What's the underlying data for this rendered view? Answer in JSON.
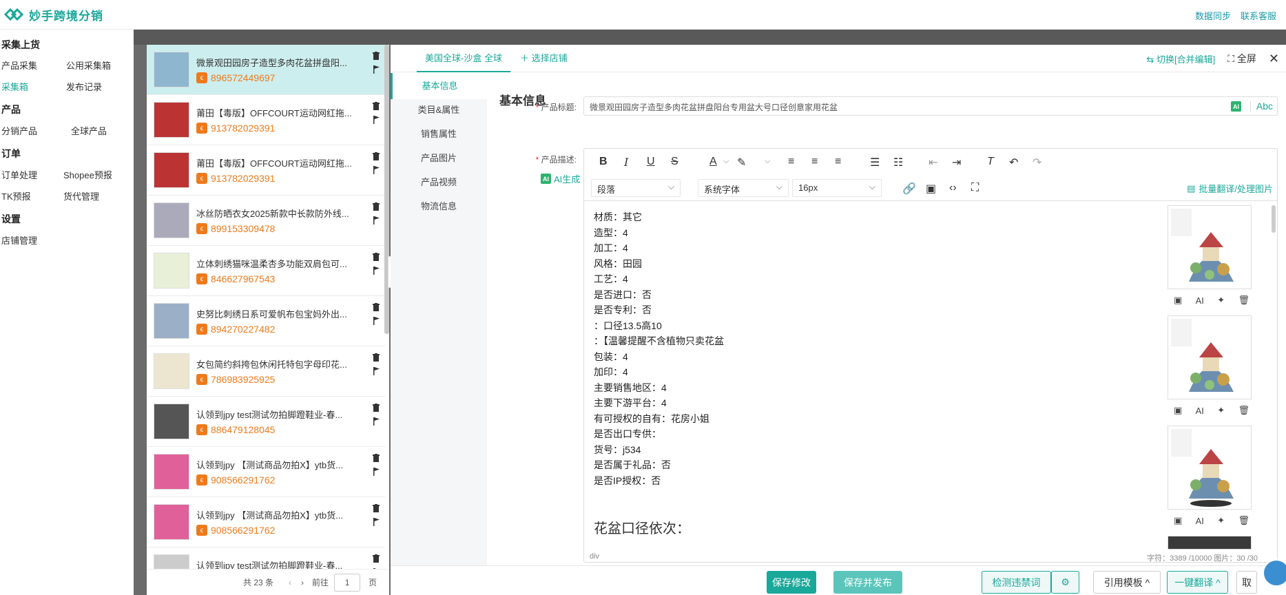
{
  "app": {
    "title": "妙手跨境分销"
  },
  "top_links": [
    "数据同步",
    "联系客服"
  ],
  "sidebar": {
    "groups": [
      {
        "label": "采集上货",
        "items": [
          "产品采集",
          "公用采集箱",
          "采集箱",
          "发布记录"
        ]
      },
      {
        "label": "产品",
        "items": [
          "分销产品",
          "全球产品"
        ]
      },
      {
        "label": "订单",
        "items": [
          "订单处理",
          "Shopee预报",
          "TK预报",
          "货代管理"
        ]
      },
      {
        "label": "设置",
        "items": [
          "店铺管理"
        ]
      }
    ],
    "active": "采集箱"
  },
  "products": [
    {
      "title": "微景观田园房子造型多肉花盆拼盘阳...",
      "id": "896572449697"
    },
    {
      "title": "莆田【毒版】OFFCOURT运动网红拖...",
      "id": "913782029391"
    },
    {
      "title": "莆田【毒版】OFFCOURT运动网红拖...",
      "id": "913782029391"
    },
    {
      "title": "冰丝防晒衣女2025新款中长款防外线...",
      "id": "899153309478"
    },
    {
      "title": "立体刺绣猫咪温柔杏多功能双肩包可...",
      "id": "846627967543"
    },
    {
      "title": "史努比刺绣日系可爱帆布包宝妈外出...",
      "id": "894270227482"
    },
    {
      "title": "女包简约斜挎包休闲托特包字母印花...",
      "id": "786983925925"
    },
    {
      "title": "认领到jpy test测试勿拍脚蹬鞋业-春...",
      "id": "886479128045"
    },
    {
      "title": "认领到jpy 【测试商品勿拍X】ytb货...",
      "id": "908566291762"
    },
    {
      "title": "认领到jpy 【测试商品勿拍X】ytb货...",
      "id": "908566291762"
    },
    {
      "title": "认领到jpy test测试勿拍脚蹬鞋业-春...",
      "id": ""
    }
  ],
  "pager": {
    "total": "共 23 条",
    "goto": "前往",
    "page": "1",
    "unit": "页"
  },
  "editor": {
    "store_tab": "美国全球-沙盒 全球",
    "add_store": "＋ 选择店铺",
    "switch": "⇆ 切换[合并编辑]",
    "fullscreen": "全屏",
    "nav": [
      "基本信息",
      "类目&属性",
      "销售属性",
      "产品图片",
      "产品视频",
      "物流信息"
    ],
    "section_title": "基本信息",
    "title_label": "产品标题:",
    "title_value": "微景观田园房子造型多肉花盆拼盘阳台专用盆大号口径创意家用花盆",
    "ai": "AI",
    "abc": "Abc",
    "desc_label": "产品描述:",
    "ai_generate": "AI生成",
    "toolbar": {
      "paragraph": "段落",
      "font": "系统字体",
      "size": "16px",
      "batch": "批量翻译/处理图片"
    },
    "desc_lines": [
      "材质：其它",
      "造型：4",
      "加工：4",
      "风格：田园",
      "工艺：4",
      "是否进口：否",
      "是否专利：否",
      "：口径13.5高10",
      "：【温馨提醒不含植物只卖花盆",
      "包装：4",
      "加印：4",
      "主要销售地区：4",
      "主要下游平台：4",
      "有可授权的自有：花房小姐",
      "是否出口专供：",
      "货号：j534",
      "是否属于礼品：否",
      "是否IP授权：否"
    ],
    "desc_big": "花盆口径依次：",
    "status_path": "div",
    "status_count": "字符：3389 /10000   图片：30 /30"
  },
  "buttons": {
    "save": "保存修改",
    "save_publish": "保存并发布",
    "check": "检测违禁词",
    "template": "引用模板 ^",
    "translate": "一键翻译 ^",
    "cut": "取"
  },
  "colors": {
    "accent": "#1aa89a",
    "id_orange": "#f07a1a"
  }
}
